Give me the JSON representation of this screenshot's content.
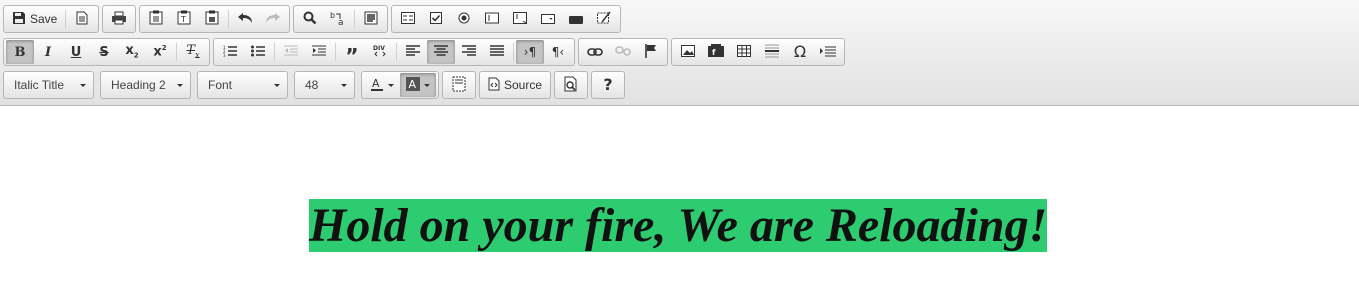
{
  "toolbar": {
    "document": {
      "save_label": "Save"
    },
    "styles": {
      "style_select": "Italic Title",
      "format_select": "Heading 2",
      "font_select": "Font",
      "size_select": "48"
    },
    "tools": {
      "source_label": "Source",
      "help_label": "?"
    }
  },
  "content": {
    "heading_text": "Hold on your fire, We are Reloading!",
    "heading_background": "#2ecc71",
    "heading_alignment": "center"
  },
  "colors": {
    "highlight": "#2ecc71",
    "active_button": "#c4c4c4"
  }
}
